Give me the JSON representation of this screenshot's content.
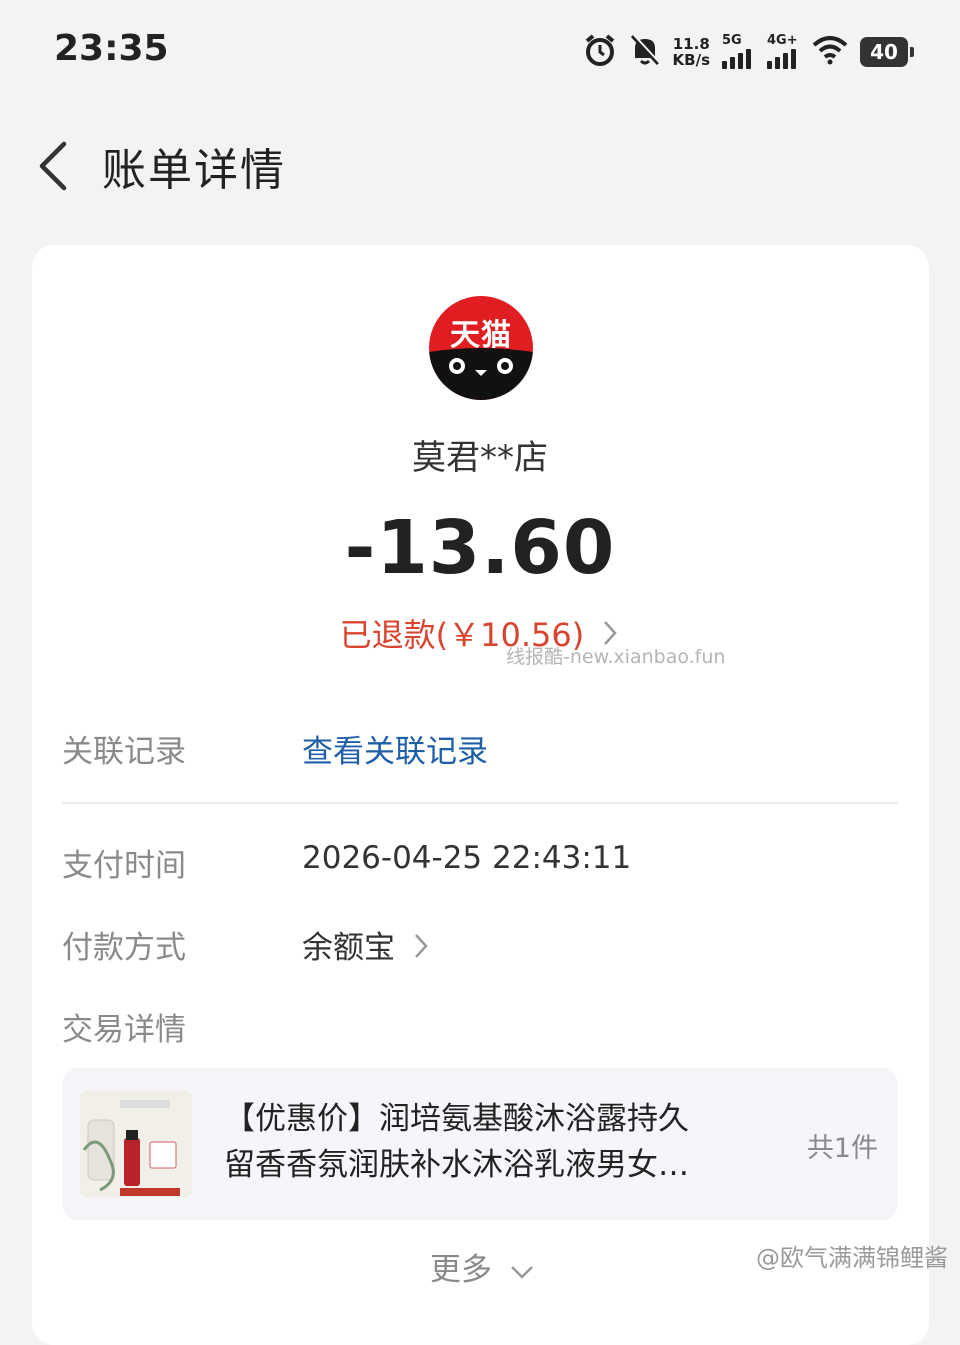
{
  "status_bar": {
    "time": "23:35",
    "net_speed_value": "11.8",
    "net_speed_unit": "KB/s",
    "network_1": "5G",
    "network_2": "4G+",
    "battery": "40",
    "icons": [
      "alarm-icon",
      "mute-icon",
      "signal-icon",
      "wifi-icon",
      "battery-icon"
    ]
  },
  "header": {
    "title": "账单详情",
    "back_icon": "chevron-left-icon"
  },
  "merchant": {
    "logo_text": "天猫",
    "name": "莫君**店"
  },
  "amount": "-13.60",
  "refund": {
    "text": "已退款(￥10.56)",
    "color": "#d9442f"
  },
  "watermark": "线报酷-new.xianbao.fun",
  "details": {
    "related_label": "关联记录",
    "related_link": "查看关联记录",
    "pay_time_label": "支付时间",
    "pay_time_value": "2026-04-25 22:43:11",
    "pay_method_label": "付款方式",
    "pay_method_value": "余额宝",
    "trade_detail_label": "交易详情"
  },
  "product": {
    "title": "【优惠价】润培氨基酸沐浴露持久留香香氛润肤补水沐浴乳液男女…",
    "title_line1": "【优惠价】润培氨基酸沐浴露持久",
    "title_line2": "留香香氛润肤补水沐浴乳液男女…",
    "count": "共1件"
  },
  "more_label": "更多",
  "credit": "@欧气满满锦鲤酱",
  "colors": {
    "accent_link": "#1f5fa8",
    "refund_red": "#d9442f",
    "background": "#f3f3f3",
    "card": "#ffffff"
  }
}
